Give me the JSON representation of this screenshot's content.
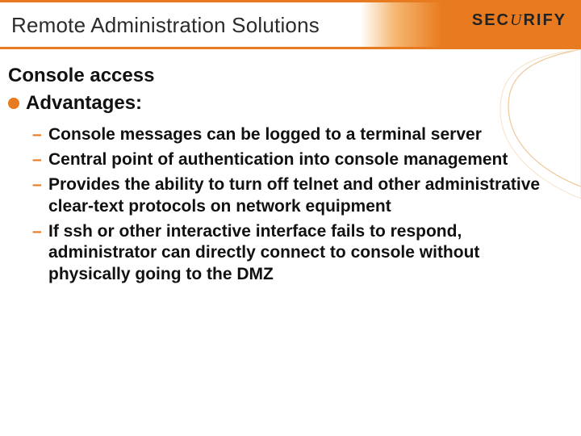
{
  "brand": {
    "part1": "SEC",
    "part2": "U",
    "part3": "RIFY"
  },
  "header": {
    "title": "Remote Administration Solutions"
  },
  "content": {
    "subtitle": "Console access",
    "advantages_label": "Advantages:",
    "bullets": [
      "Console messages can be logged to a terminal server",
      "Central point of authentication into console management",
      "Provides the ability to turn off telnet and other administrative clear-text protocols on network equipment",
      "If ssh or other interactive interface fails to respond, administrator can directly connect to console without physically going to the DMZ"
    ]
  },
  "colors": {
    "accent": "#e87b1f"
  }
}
